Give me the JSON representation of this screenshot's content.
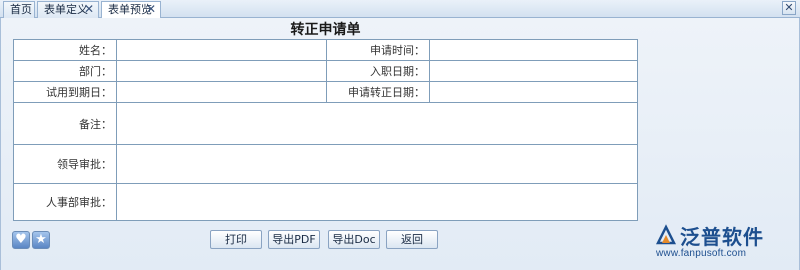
{
  "tabs": [
    {
      "label": "首页",
      "closable": false
    },
    {
      "label": "表单定义",
      "closable": true
    },
    {
      "label": "表单预览",
      "closable": true,
      "active": true
    }
  ],
  "form": {
    "title": "转正申请单",
    "fields": {
      "name": "姓名：",
      "apply_time": "申请时间：",
      "department": "部门：",
      "join_date": "入职日期：",
      "probation_end": "试用到期日：",
      "regular_date": "申请转正日期：",
      "remarks": "备注：",
      "leader_approval": "领导审批：",
      "hr_approval": "人事部审批："
    }
  },
  "buttons": {
    "print": "打印",
    "export_pdf": "导出PDF",
    "export_doc": "导出Doc",
    "back": "返回"
  },
  "icons": {
    "close": "✕",
    "heart": "♥",
    "star": "★"
  },
  "logo": {
    "name": "泛普软件",
    "url": "www.fanpusoft.com"
  }
}
